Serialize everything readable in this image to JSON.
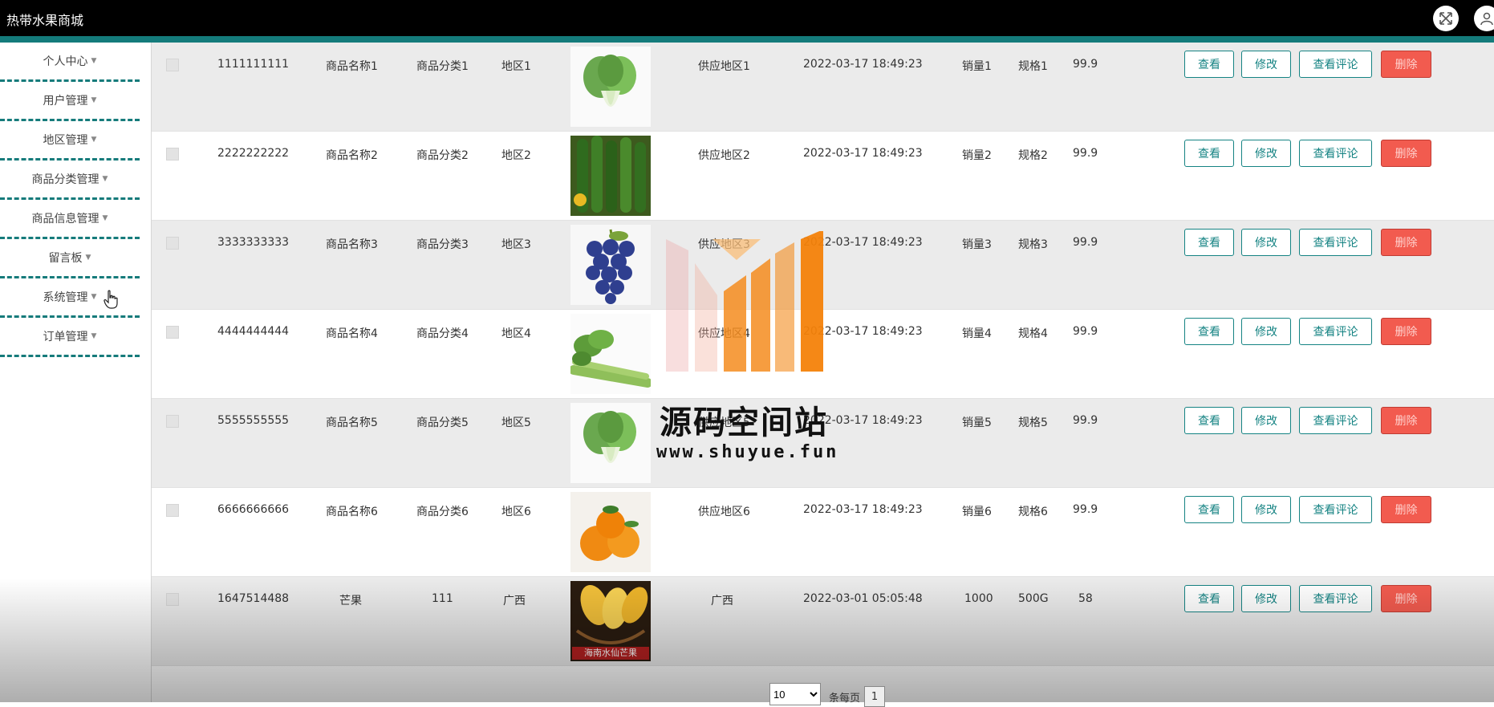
{
  "app": {
    "title": "热带水果商城"
  },
  "header": {
    "fullscreen_icon": "expand-icon",
    "user_icon": "user-icon"
  },
  "sidebar": {
    "items": [
      {
        "label": "个人中心"
      },
      {
        "label": "用户管理"
      },
      {
        "label": "地区管理"
      },
      {
        "label": "商品分类管理"
      },
      {
        "label": "商品信息管理"
      },
      {
        "label": "留言板"
      },
      {
        "label": "系统管理"
      },
      {
        "label": "订单管理"
      }
    ]
  },
  "actions": {
    "view": "查看",
    "edit": "修改",
    "comments": "查看评论",
    "delete": "删除"
  },
  "rows": [
    {
      "id": "1111111111",
      "name": "商品名称1",
      "category": "商品分类1",
      "region": "地区1",
      "image": "bok choy",
      "supply_region": "供应地区1",
      "time": "2022-03-17 18:49:23",
      "sales": "销量1",
      "spec": "规格1",
      "price": "99.9"
    },
    {
      "id": "2222222222",
      "name": "商品名称2",
      "category": "商品分类2",
      "region": "地区2",
      "image": "cucumbers",
      "supply_region": "供应地区2",
      "time": "2022-03-17 18:49:23",
      "sales": "销量2",
      "spec": "规格2",
      "price": "99.9"
    },
    {
      "id": "3333333333",
      "name": "商品名称3",
      "category": "商品分类3",
      "region": "地区3",
      "image": "grapes",
      "supply_region": "供应地区3",
      "time": "2022-03-17 18:49:23",
      "sales": "销量3",
      "spec": "规格3",
      "price": "99.9"
    },
    {
      "id": "4444444444",
      "name": "商品名称4",
      "category": "商品分类4",
      "region": "地区4",
      "image": "celery",
      "supply_region": "供应地区4",
      "time": "2022-03-17 18:49:23",
      "sales": "销量4",
      "spec": "规格4",
      "price": "99.9"
    },
    {
      "id": "5555555555",
      "name": "商品名称5",
      "category": "商品分类5",
      "region": "地区5",
      "image": "bok choy",
      "supply_region": "供应地区5",
      "time": "2022-03-17 18:49:23",
      "sales": "销量5",
      "spec": "规格5",
      "price": "99.9"
    },
    {
      "id": "6666666666",
      "name": "商品名称6",
      "category": "商品分类6",
      "region": "地区6",
      "image": "oranges",
      "supply_region": "供应地区6",
      "time": "2022-03-17 18:49:23",
      "sales": "销量6",
      "spec": "规格6",
      "price": "99.9"
    },
    {
      "id": "1647514488",
      "name": "芒果",
      "category": "111",
      "region": "广西",
      "image": "mangoes",
      "image_caption": "海南水仙芒果",
      "supply_region": "广西",
      "time": "2022-03-01 05:05:48",
      "sales": "1000",
      "spec": "500G",
      "price": "58"
    }
  ],
  "pagination": {
    "page_size": "10",
    "per_page_label": "条每页",
    "page": "1"
  },
  "watermark": {
    "title": "源码空间站",
    "url": "www.shuyue.fun"
  },
  "colors": {
    "accent": "#147b7b",
    "delete": "#f25b4f",
    "topbar": "#000000"
  }
}
